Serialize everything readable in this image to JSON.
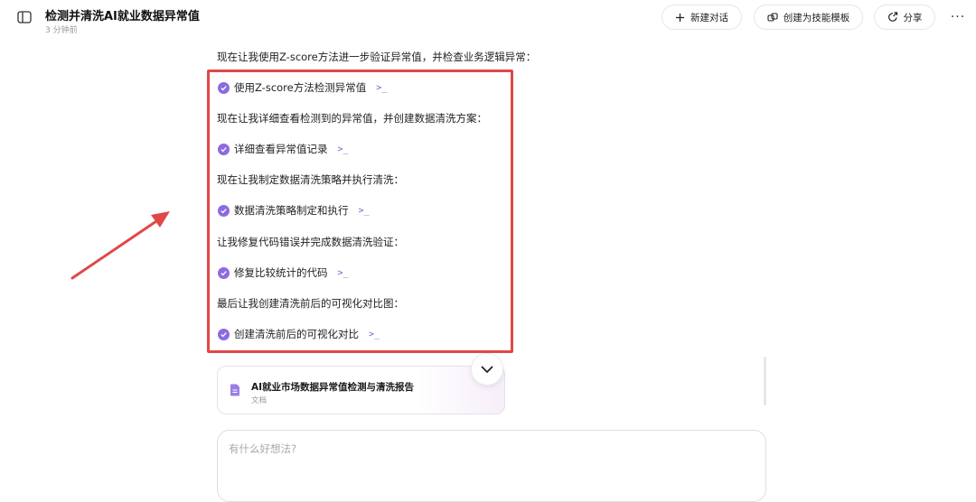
{
  "header": {
    "title": "检测并清洗AI就业数据异常值",
    "subtitle": "3 分钟前",
    "new_chat_label": "新建对话",
    "create_template_label": "创建为技能模板",
    "share_label": "分享",
    "more_label": "···",
    "icons": [
      "sidebar-toggle-icon",
      "plus-icon",
      "link-icon",
      "share-icon",
      "more-icon"
    ]
  },
  "conversation": {
    "intro": "现在让我使用Z-score方法进一步验证异常值，并检查业务逻辑异常：",
    "steps": [
      {
        "label": "使用Z-score方法检测异常值",
        "expand": ">_"
      },
      {
        "text": "现在让我详细查看检测到的异常值，并创建数据清洗方案："
      },
      {
        "label": "详细查看异常值记录",
        "expand": ">_"
      },
      {
        "text": "现在让我制定数据清洗策略并执行清洗："
      },
      {
        "label": "数据清洗策略制定和执行",
        "expand": ">_"
      },
      {
        "text": "让我修复代码错误并完成数据清洗验证："
      },
      {
        "label": "修复比较统计的代码",
        "expand": ">_"
      },
      {
        "text": "最后让我创建清洗前后的可视化对比图："
      },
      {
        "label": "创建清洗前后的可视化对比",
        "expand": ">_"
      }
    ]
  },
  "document": {
    "title": "AI就业市场数据异常值检测与清洗报告",
    "type": "文档"
  },
  "input": {
    "placeholder": "有什么好想法?"
  },
  "colors": {
    "accent": "#8c6be0",
    "highlight": "#e04848"
  }
}
